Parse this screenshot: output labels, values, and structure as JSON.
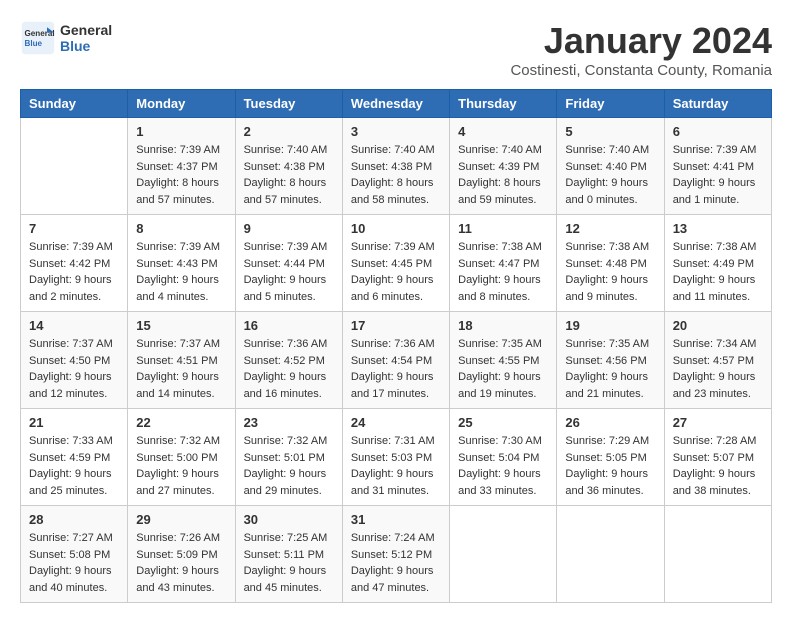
{
  "header": {
    "logo_line1": "General",
    "logo_line2": "Blue",
    "month_title": "January 2024",
    "location": "Costinesti, Constanta County, Romania"
  },
  "days_of_week": [
    "Sunday",
    "Monday",
    "Tuesday",
    "Wednesday",
    "Thursday",
    "Friday",
    "Saturday"
  ],
  "weeks": [
    [
      {
        "day": "",
        "sunrise": "",
        "sunset": "",
        "daylight": ""
      },
      {
        "day": "1",
        "sunrise": "Sunrise: 7:39 AM",
        "sunset": "Sunset: 4:37 PM",
        "daylight": "Daylight: 8 hours and 57 minutes."
      },
      {
        "day": "2",
        "sunrise": "Sunrise: 7:40 AM",
        "sunset": "Sunset: 4:38 PM",
        "daylight": "Daylight: 8 hours and 57 minutes."
      },
      {
        "day": "3",
        "sunrise": "Sunrise: 7:40 AM",
        "sunset": "Sunset: 4:38 PM",
        "daylight": "Daylight: 8 hours and 58 minutes."
      },
      {
        "day": "4",
        "sunrise": "Sunrise: 7:40 AM",
        "sunset": "Sunset: 4:39 PM",
        "daylight": "Daylight: 8 hours and 59 minutes."
      },
      {
        "day": "5",
        "sunrise": "Sunrise: 7:40 AM",
        "sunset": "Sunset: 4:40 PM",
        "daylight": "Daylight: 9 hours and 0 minutes."
      },
      {
        "day": "6",
        "sunrise": "Sunrise: 7:39 AM",
        "sunset": "Sunset: 4:41 PM",
        "daylight": "Daylight: 9 hours and 1 minute."
      }
    ],
    [
      {
        "day": "7",
        "sunrise": "Sunrise: 7:39 AM",
        "sunset": "Sunset: 4:42 PM",
        "daylight": "Daylight: 9 hours and 2 minutes."
      },
      {
        "day": "8",
        "sunrise": "Sunrise: 7:39 AM",
        "sunset": "Sunset: 4:43 PM",
        "daylight": "Daylight: 9 hours and 4 minutes."
      },
      {
        "day": "9",
        "sunrise": "Sunrise: 7:39 AM",
        "sunset": "Sunset: 4:44 PM",
        "daylight": "Daylight: 9 hours and 5 minutes."
      },
      {
        "day": "10",
        "sunrise": "Sunrise: 7:39 AM",
        "sunset": "Sunset: 4:45 PM",
        "daylight": "Daylight: 9 hours and 6 minutes."
      },
      {
        "day": "11",
        "sunrise": "Sunrise: 7:38 AM",
        "sunset": "Sunset: 4:47 PM",
        "daylight": "Daylight: 9 hours and 8 minutes."
      },
      {
        "day": "12",
        "sunrise": "Sunrise: 7:38 AM",
        "sunset": "Sunset: 4:48 PM",
        "daylight": "Daylight: 9 hours and 9 minutes."
      },
      {
        "day": "13",
        "sunrise": "Sunrise: 7:38 AM",
        "sunset": "Sunset: 4:49 PM",
        "daylight": "Daylight: 9 hours and 11 minutes."
      }
    ],
    [
      {
        "day": "14",
        "sunrise": "Sunrise: 7:37 AM",
        "sunset": "Sunset: 4:50 PM",
        "daylight": "Daylight: 9 hours and 12 minutes."
      },
      {
        "day": "15",
        "sunrise": "Sunrise: 7:37 AM",
        "sunset": "Sunset: 4:51 PM",
        "daylight": "Daylight: 9 hours and 14 minutes."
      },
      {
        "day": "16",
        "sunrise": "Sunrise: 7:36 AM",
        "sunset": "Sunset: 4:52 PM",
        "daylight": "Daylight: 9 hours and 16 minutes."
      },
      {
        "day": "17",
        "sunrise": "Sunrise: 7:36 AM",
        "sunset": "Sunset: 4:54 PM",
        "daylight": "Daylight: 9 hours and 17 minutes."
      },
      {
        "day": "18",
        "sunrise": "Sunrise: 7:35 AM",
        "sunset": "Sunset: 4:55 PM",
        "daylight": "Daylight: 9 hours and 19 minutes."
      },
      {
        "day": "19",
        "sunrise": "Sunrise: 7:35 AM",
        "sunset": "Sunset: 4:56 PM",
        "daylight": "Daylight: 9 hours and 21 minutes."
      },
      {
        "day": "20",
        "sunrise": "Sunrise: 7:34 AM",
        "sunset": "Sunset: 4:57 PM",
        "daylight": "Daylight: 9 hours and 23 minutes."
      }
    ],
    [
      {
        "day": "21",
        "sunrise": "Sunrise: 7:33 AM",
        "sunset": "Sunset: 4:59 PM",
        "daylight": "Daylight: 9 hours and 25 minutes."
      },
      {
        "day": "22",
        "sunrise": "Sunrise: 7:32 AM",
        "sunset": "Sunset: 5:00 PM",
        "daylight": "Daylight: 9 hours and 27 minutes."
      },
      {
        "day": "23",
        "sunrise": "Sunrise: 7:32 AM",
        "sunset": "Sunset: 5:01 PM",
        "daylight": "Daylight: 9 hours and 29 minutes."
      },
      {
        "day": "24",
        "sunrise": "Sunrise: 7:31 AM",
        "sunset": "Sunset: 5:03 PM",
        "daylight": "Daylight: 9 hours and 31 minutes."
      },
      {
        "day": "25",
        "sunrise": "Sunrise: 7:30 AM",
        "sunset": "Sunset: 5:04 PM",
        "daylight": "Daylight: 9 hours and 33 minutes."
      },
      {
        "day": "26",
        "sunrise": "Sunrise: 7:29 AM",
        "sunset": "Sunset: 5:05 PM",
        "daylight": "Daylight: 9 hours and 36 minutes."
      },
      {
        "day": "27",
        "sunrise": "Sunrise: 7:28 AM",
        "sunset": "Sunset: 5:07 PM",
        "daylight": "Daylight: 9 hours and 38 minutes."
      }
    ],
    [
      {
        "day": "28",
        "sunrise": "Sunrise: 7:27 AM",
        "sunset": "Sunset: 5:08 PM",
        "daylight": "Daylight: 9 hours and 40 minutes."
      },
      {
        "day": "29",
        "sunrise": "Sunrise: 7:26 AM",
        "sunset": "Sunset: 5:09 PM",
        "daylight": "Daylight: 9 hours and 43 minutes."
      },
      {
        "day": "30",
        "sunrise": "Sunrise: 7:25 AM",
        "sunset": "Sunset: 5:11 PM",
        "daylight": "Daylight: 9 hours and 45 minutes."
      },
      {
        "day": "31",
        "sunrise": "Sunrise: 7:24 AM",
        "sunset": "Sunset: 5:12 PM",
        "daylight": "Daylight: 9 hours and 47 minutes."
      },
      {
        "day": "",
        "sunrise": "",
        "sunset": "",
        "daylight": ""
      },
      {
        "day": "",
        "sunrise": "",
        "sunset": "",
        "daylight": ""
      },
      {
        "day": "",
        "sunrise": "",
        "sunset": "",
        "daylight": ""
      }
    ]
  ]
}
